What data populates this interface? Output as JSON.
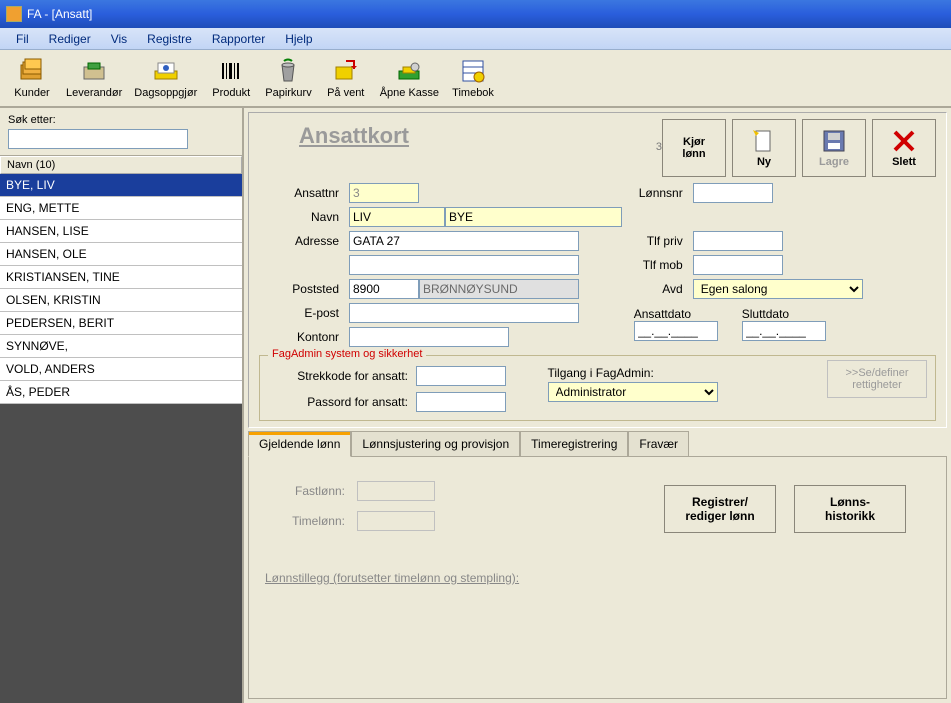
{
  "window": {
    "title": "FA - [Ansatt]"
  },
  "menu": {
    "items": [
      "Fil",
      "Rediger",
      "Vis",
      "Registre",
      "Rapporter",
      "Hjelp"
    ]
  },
  "toolbar": {
    "items": [
      {
        "label": "Kunder",
        "icon": "folder-stack-icon"
      },
      {
        "label": "Leverandør",
        "icon": "supplier-icon"
      },
      {
        "label": "Dagsoppgjør",
        "icon": "day-settlement-icon"
      },
      {
        "label": "Produkt",
        "icon": "barcode-icon"
      },
      {
        "label": "Papirkurv",
        "icon": "trash-icon"
      },
      {
        "label": "På vent",
        "icon": "on-hold-icon"
      },
      {
        "label": "Åpne Kasse",
        "icon": "open-register-icon"
      },
      {
        "label": "Timebok",
        "icon": "schedule-icon"
      }
    ]
  },
  "search": {
    "label": "Søk etter:",
    "value": ""
  },
  "list": {
    "header": "Navn (10)",
    "rows": [
      "BYE, LIV",
      "ENG, METTE",
      "HANSEN, LISE",
      "HANSEN, OLE",
      "KRISTIANSEN, TINE",
      "OLSEN, KRISTIN",
      "PEDERSEN, BERIT",
      "SYNNØVE,",
      "VOLD, ANDERS",
      "ÅS, PEDER"
    ],
    "selected": 0
  },
  "card": {
    "title": "Ansattkort",
    "idnum": "3",
    "actions": {
      "run_salary": "Kjør\nlønn",
      "new": "Ny",
      "save": "Lagre",
      "delete": "Slett"
    },
    "labels": {
      "ansattnr": "Ansattnr",
      "lonnsnr": "Lønnsnr",
      "navn": "Navn",
      "adresse": "Adresse",
      "poststed": "Poststed",
      "epost": "E-post",
      "kontonr": "Kontonr",
      "tlf_priv": "Tlf priv",
      "tlf_mob": "Tlf mob",
      "avd": "Avd",
      "ansattdato": "Ansattdato",
      "sluttdato": "Sluttdato"
    },
    "values": {
      "ansattnr": "3",
      "lonnsnr": "",
      "fornavn": "LIV",
      "etternavn": "BYE",
      "adresse1": "GATA 27",
      "adresse2": "",
      "postnr": "8900",
      "poststed": "BRØNNØYSUND",
      "epost": "",
      "kontonr": "",
      "tlf_priv": "",
      "tlf_mob": "",
      "avd": "Egen salong",
      "ansattdato": "__.__.____",
      "sluttdato": "__.__.____"
    }
  },
  "security": {
    "legend": "FagAdmin system og sikkerhet",
    "barcode_label": "Strekkode for ansatt:",
    "password_label": "Passord for ansatt:",
    "access_label": "Tilgang i FagAdmin:",
    "access_value": "Administrator",
    "rights_btn": ">>Se/definer\nrettigheter",
    "barcode_value": "",
    "password_value": ""
  },
  "tabs": {
    "items": [
      "Gjeldende lønn",
      "Lønnsjustering og provisjon",
      "Timeregistrering",
      "Fravær"
    ],
    "active": 0
  },
  "salary_tab": {
    "fastlonn_label": "Fastlønn:",
    "timelonn_label": "Timelønn:",
    "reg_btn": "Registrer/\nrediger lønn",
    "hist_btn": "Lønns-\nhistorikk",
    "addon_link": "Lønnstillegg (forutsetter timelønn og stempling):"
  }
}
